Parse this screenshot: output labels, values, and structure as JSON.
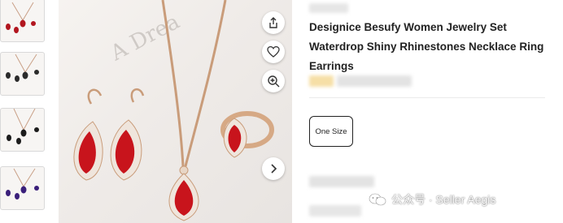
{
  "thumbnails": [
    {
      "label": "",
      "gem_color": "#b2161f"
    },
    {
      "label": "",
      "gem_color": "#2b2b2b"
    },
    {
      "label": "",
      "gem_color": "#1c1c1c"
    },
    {
      "label": "",
      "gem_color": "#3a1f7a"
    }
  ],
  "image": {
    "background_text": "A Drea",
    "gem_color": "#c8141c",
    "metal_color": "#c99c7a"
  },
  "actions": {
    "share_icon": "share-icon",
    "favorite_icon": "heart-icon",
    "zoom_icon": "zoom-in-icon",
    "next_icon": "chevron-right-icon"
  },
  "product": {
    "title": "Designice Besufy Women Jewelry Set Waterdrop Shiny Rhinestones Necklace Ring Earrings",
    "size_option": "One Size"
  },
  "watermark": {
    "text": "公众号 · Seller Aegis"
  },
  "colors": {
    "accent_dark": "#222222",
    "divider": "#ebebeb",
    "blurred_price": "#f3d9a0"
  }
}
